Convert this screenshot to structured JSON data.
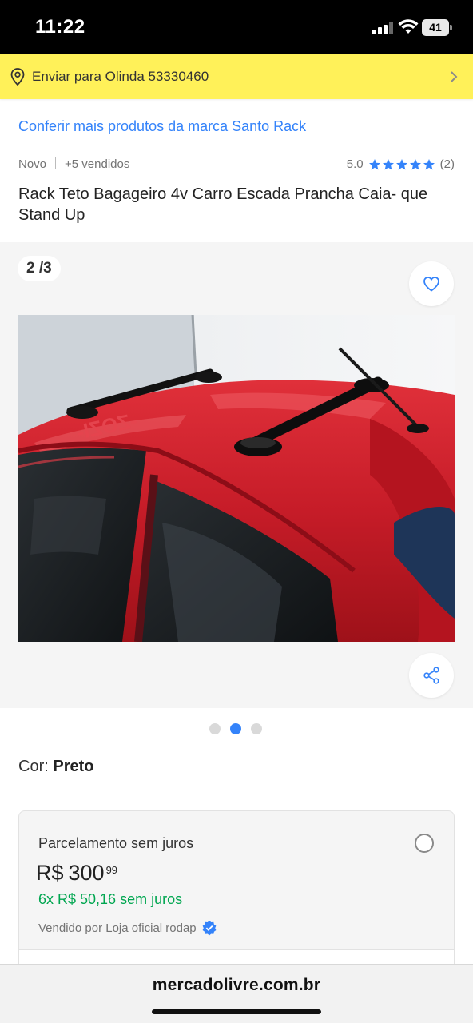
{
  "status_bar": {
    "time": "11:22",
    "battery": "41",
    "icons": [
      "signal-icon",
      "wifi-icon",
      "battery-icon"
    ]
  },
  "shipping": {
    "text": "Enviar para Olinda 53330460",
    "icon": "location-pin-icon",
    "background": "#fff159"
  },
  "product": {
    "brand_link": "Conferir mais produtos da marca Santo Rack",
    "condition": "Novo",
    "sold": "+5 vendidos",
    "rating": "5.0",
    "rating_stars": 5,
    "reviews": "(2)",
    "title": "Rack Teto Bagageiro 4v Carro Escada Prancha Caia- que Stand Up"
  },
  "gallery": {
    "counter": "2 /3",
    "current": 2,
    "total": 3,
    "favorite_icon": "heart-icon",
    "share_icon": "share-icon"
  },
  "variant": {
    "label": "Cor:",
    "value": "Preto"
  },
  "payment": {
    "title": "Parcelamento sem juros",
    "currency": "R$",
    "price_int": "300",
    "price_cents": "99",
    "installments": "6x R$ 50,16 sem juros",
    "seller": "Vendido por Loja oficial rodap",
    "seller_icon": "verified-badge-icon"
  },
  "browser": {
    "url": "mercadolivre.com.br"
  },
  "colors": {
    "accent": "#3483fa",
    "green": "#00a650",
    "yellow": "#fff159"
  }
}
